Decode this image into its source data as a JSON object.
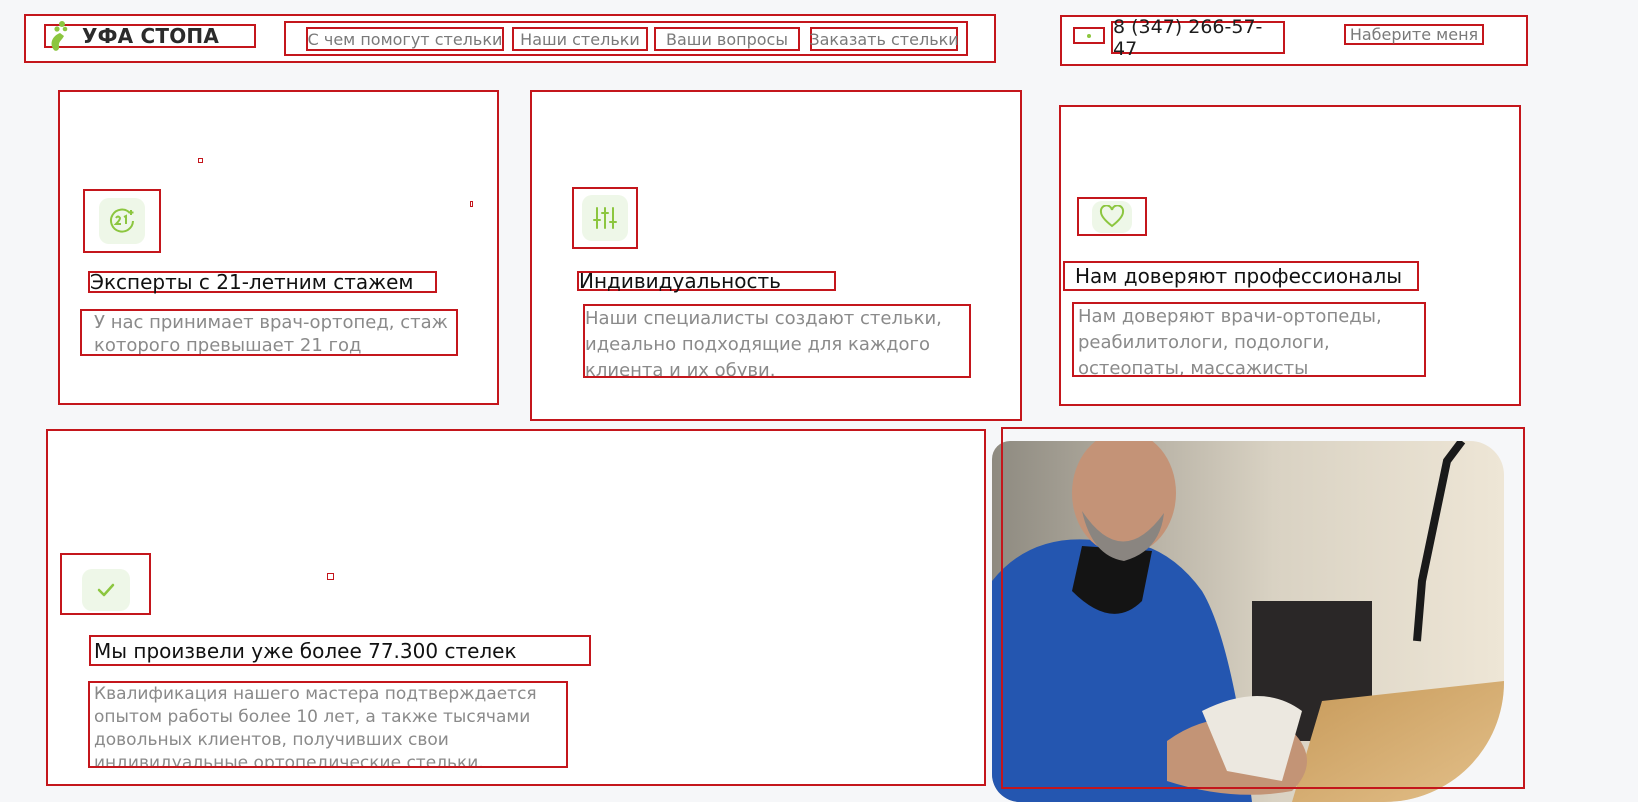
{
  "brand": {
    "name": "УФА СТОПА",
    "accent": "#8cc63f"
  },
  "nav": {
    "items": [
      "С чем помогут стельки",
      "Наши стельки",
      "Ваши вопросы",
      "Заказать стельки"
    ]
  },
  "contact": {
    "phone": "8 (347) 266-57-47",
    "callback": "Наберите меня"
  },
  "features": [
    {
      "icon": "badge-21-icon",
      "title": "Эксперты с 21-летним стажем",
      "text": "У нас принимает врач-ортопед, стаж которого превышает 21 год"
    },
    {
      "icon": "sliders-icon",
      "title": "Индивидуальность",
      "text": "Наши специалисты создают стельки, идеально подходящие для каждого клиента и их обуви."
    },
    {
      "icon": "heart-icon",
      "title": "Нам доверяют профессионалы",
      "text": "Нам доверяют врачи-ортопеды, реабилитологи, подологи, остеопаты, массажисты"
    },
    {
      "icon": "check-icon",
      "title": "Мы произвели уже более 77.300 стелек",
      "text": "Квалификация нашего мастера подтверждается опытом работы более 10 лет, а также тысячами довольных клиентов, получивших свои индивидуальные ортопедические стельки."
    }
  ],
  "colors": {
    "outline": "#c4161c",
    "icon_bg": "#eef7e8",
    "icon_fg": "#8cc63f",
    "muted_text": "#8a8a8a"
  }
}
